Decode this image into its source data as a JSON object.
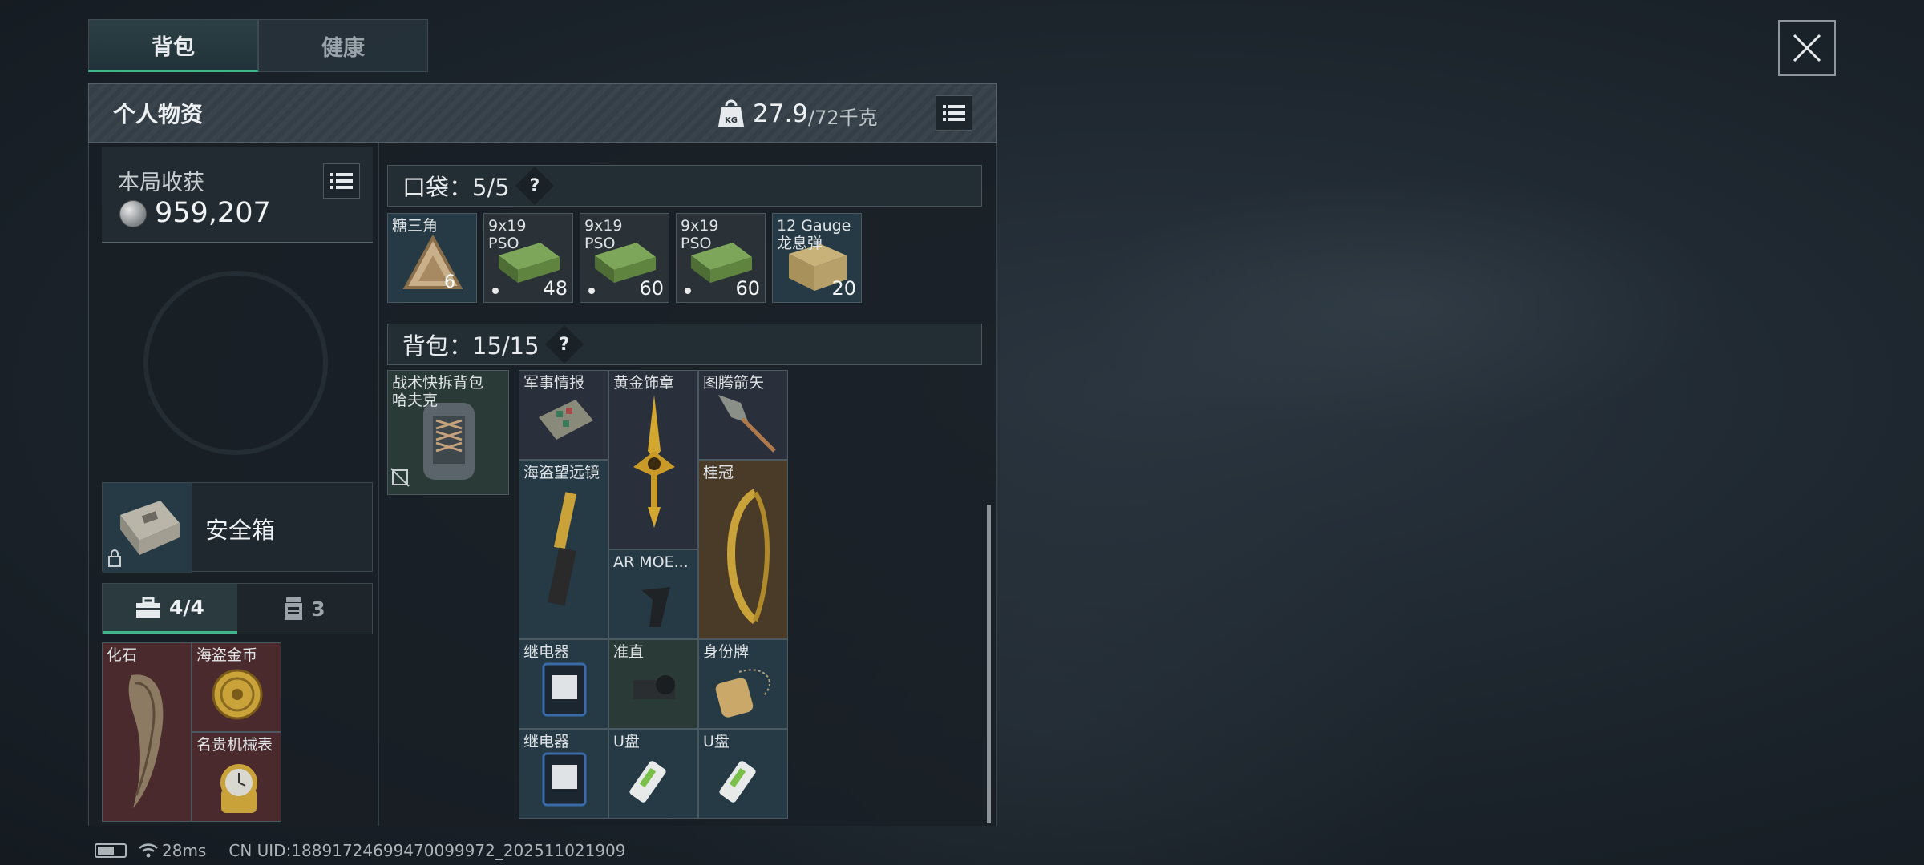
{
  "tabs": [
    {
      "label": "背包",
      "active": true
    },
    {
      "label": "健康",
      "active": false
    }
  ],
  "header": {
    "title": "个人物资",
    "weight_current": "27.9",
    "weight_max": "/72千克",
    "weight_icon": "kg-weight-icon"
  },
  "harvest": {
    "label": "本局收获",
    "value": "959,207"
  },
  "safe_box": {
    "label": "安全箱"
  },
  "sub_tabs": [
    {
      "label": "4/4",
      "icon": "toolbox-icon",
      "active": true
    },
    {
      "label": "3",
      "icon": "canister-icon",
      "active": false
    }
  ],
  "secure_items": [
    {
      "name": "化石"
    },
    {
      "name": "海盗金币"
    },
    {
      "name": "名贵机械表"
    }
  ],
  "pockets": {
    "label": "口袋：5/5",
    "help": "?",
    "items": [
      {
        "name": "糖三角",
        "qty": ""
      },
      {
        "name": "9x19\nPSO",
        "qty": "48"
      },
      {
        "name": "9x19\nPSO",
        "qty": "60"
      },
      {
        "name": "9x19\nPSO",
        "qty": "60"
      },
      {
        "name": "12 Gauge\n龙息弹",
        "qty": "20"
      }
    ]
  },
  "backpack": {
    "label": "背包：15/15",
    "help": "?",
    "equipped": {
      "name": "战术快拆背包\n哈夫克"
    },
    "items": [
      {
        "name": "军事情报"
      },
      {
        "name": "黄金饰章"
      },
      {
        "name": "图腾箭矢"
      },
      {
        "name": "海盗望远镜"
      },
      {
        "name": "桂冠"
      },
      {
        "name": "AR MOE..."
      },
      {
        "name": "继电器"
      },
      {
        "name": "准直"
      },
      {
        "name": "身份牌"
      },
      {
        "name": "继电器"
      },
      {
        "name": "U盘"
      },
      {
        "name": "U盘"
      }
    ]
  },
  "status": {
    "ping": "28ms",
    "uid": "CN UID:18891724699470099972_202511021909"
  }
}
